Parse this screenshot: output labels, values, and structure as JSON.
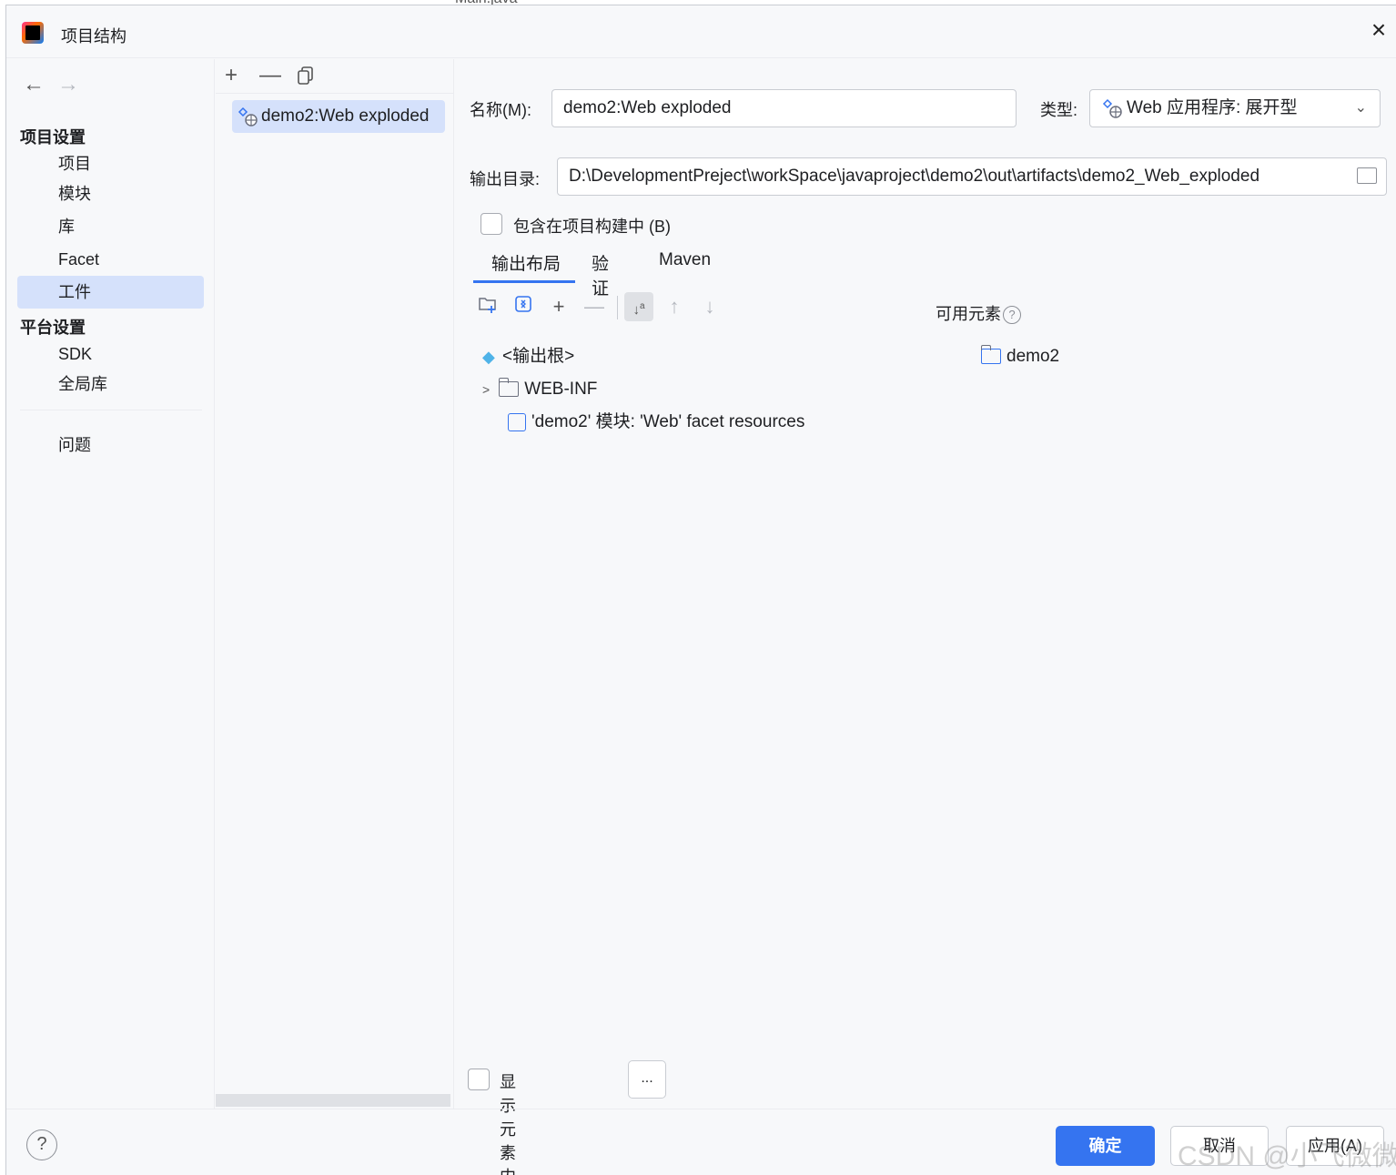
{
  "background": {
    "tab_label": "Main.java"
  },
  "dialog": {
    "title": "项目结构"
  },
  "nav": {
    "sections": [
      {
        "title": "项目设置",
        "items": [
          "项目",
          "模块",
          "库",
          "Facet",
          "工件"
        ]
      },
      {
        "title": "平台设置",
        "items": [
          "SDK",
          "全局库"
        ]
      }
    ],
    "problems": "问题",
    "selected": "工件"
  },
  "artifacts": {
    "items": [
      "demo2:Web exploded"
    ]
  },
  "form": {
    "name_label": "名称(M):",
    "name_value": "demo2:Web exploded",
    "type_label": "类型:",
    "type_value": "Web 应用程序: 展开型",
    "output_label": "输出目录:",
    "output_value": "D:\\DevelopmentPreject\\workSpace\\javaproject\\demo2\\out\\artifacts\\demo2_Web_exploded",
    "include_in_build": "包含在项目构建中 (B)",
    "include_in_build_checked": false
  },
  "tabs": [
    "输出布局",
    "验证",
    "Maven"
  ],
  "active_tab": "输出布局",
  "layout": {
    "available_label": "可用元素",
    "tree": {
      "root": "<输出根>",
      "children": [
        {
          "label": "WEB-INF",
          "type": "folder",
          "expandable": true
        },
        {
          "label": "'demo2' 模块: 'Web' facet resources",
          "type": "web-resource"
        }
      ]
    },
    "available": [
      {
        "label": "demo2",
        "type": "module-folder"
      }
    ],
    "show_content": "显示元素内容",
    "show_content_checked": false,
    "ellipsis": "..."
  },
  "footer": {
    "help": "?",
    "ok": "确定",
    "cancel": "取消",
    "apply": "应用(A)"
  },
  "watermark": "CSDN @小飞微微",
  "colors": {
    "accent": "#3574f0",
    "selection": "#d5e1fb",
    "panel": "#f7f8fa"
  }
}
